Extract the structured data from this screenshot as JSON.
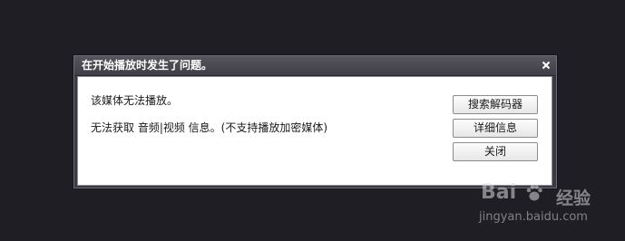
{
  "dialog": {
    "title": "在开始播放时发生了问题。",
    "close_glyph": "×",
    "messages": [
      "该媒体无法播放。",
      "无法获取 音频|视频 信息。(不支持播放加密媒体)"
    ],
    "buttons": [
      "搜索解码器",
      "详细信息",
      "关闭"
    ]
  },
  "watermark": {
    "logo_text_left": "Bai",
    "logo_text_right": "经验",
    "url": "jingyan.baidu.com"
  },
  "colors": {
    "background": "#1f1e24",
    "titlebar": "#4a4951",
    "content": "#ffffff"
  }
}
